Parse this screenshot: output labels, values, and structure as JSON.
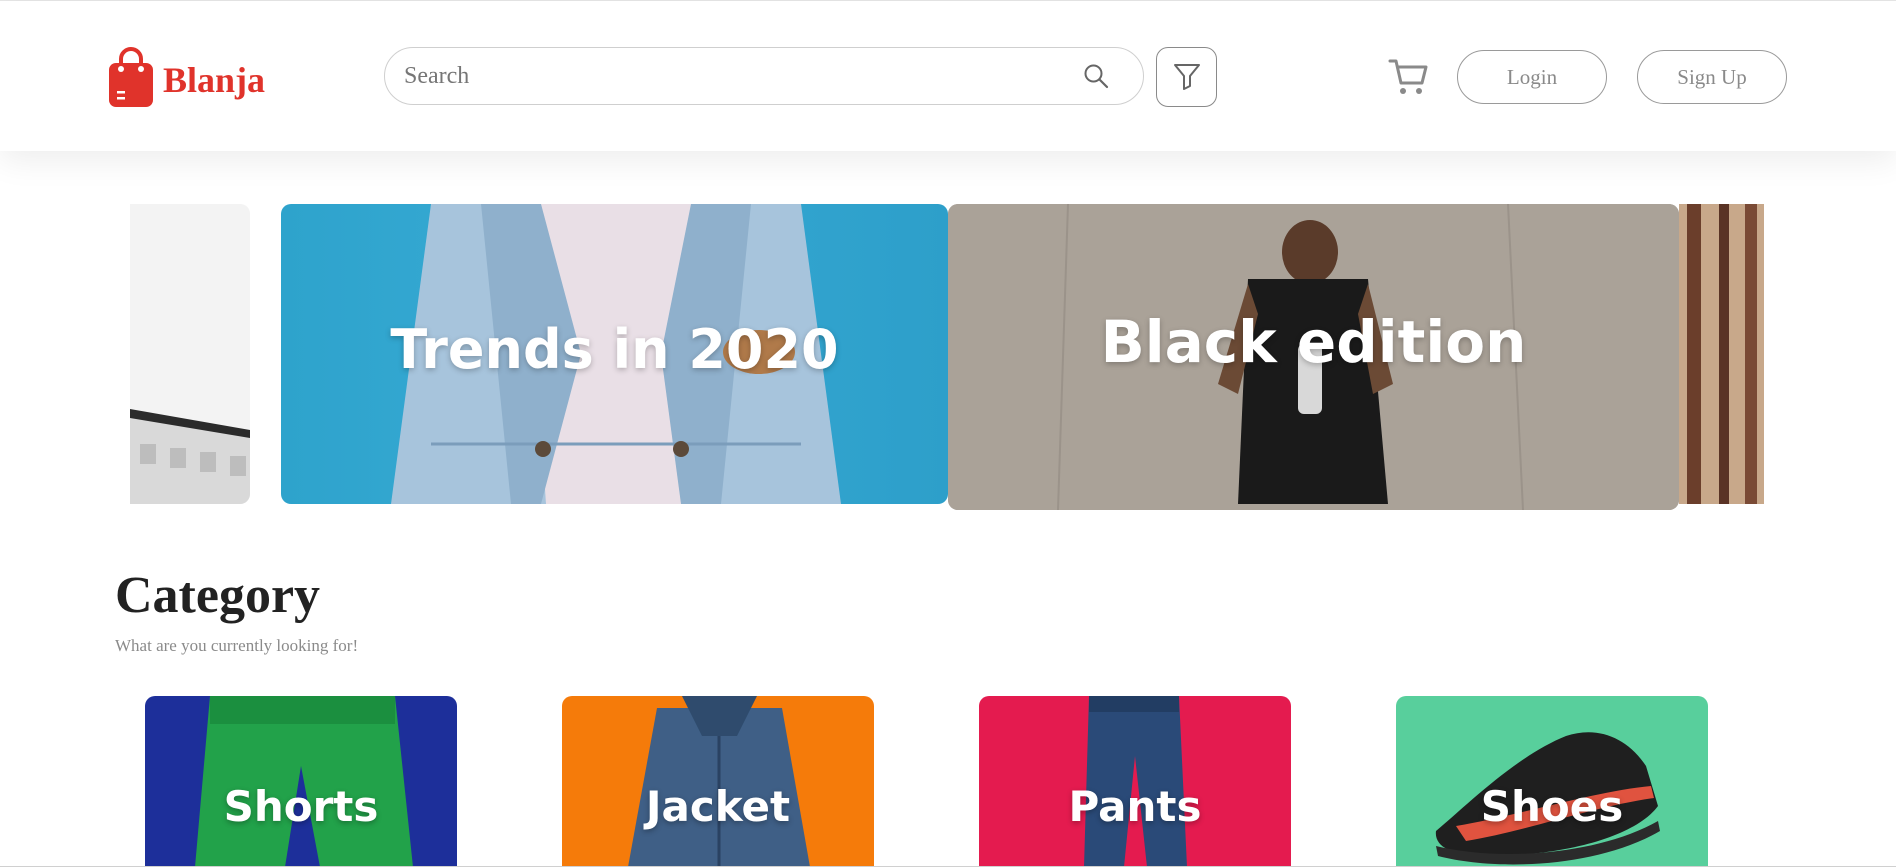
{
  "brand": {
    "name": "Blanja",
    "color": "#e0332b"
  },
  "header": {
    "search_placeholder": "Search",
    "login_label": "Login",
    "signup_label": "Sign Up",
    "icons": [
      "search-icon",
      "filter-icon",
      "cart-icon"
    ]
  },
  "banners": [
    {
      "title": ""
    },
    {
      "title": "Trends in 2020"
    },
    {
      "title": "Black edition"
    },
    {
      "title": ""
    }
  ],
  "category": {
    "heading": "Category",
    "subtitle": "What are you currently looking for!",
    "items": [
      {
        "label": "Shorts",
        "color": "#1d2f9a"
      },
      {
        "label": "Jacket",
        "color": "#f57b0a"
      },
      {
        "label": "Pants",
        "color": "#e41b4f"
      },
      {
        "label": "Shoes",
        "color": "#58cf9c"
      }
    ]
  }
}
